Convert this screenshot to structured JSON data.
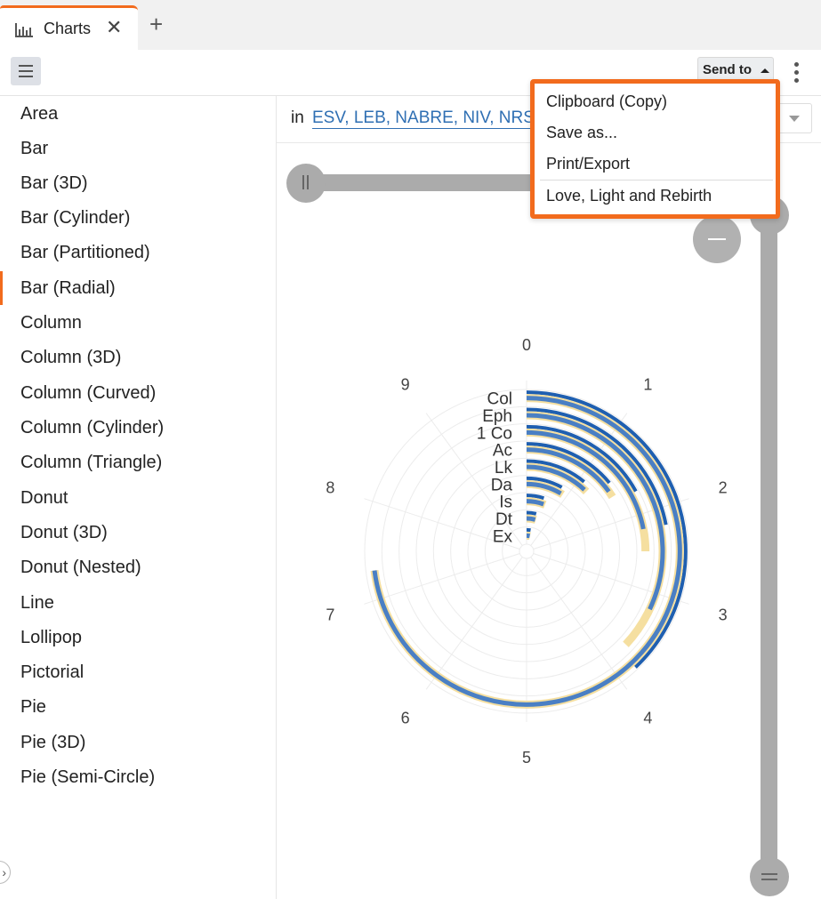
{
  "tab": {
    "title": "Charts",
    "icon": "bar-chart-icon"
  },
  "toolbar": {
    "send_to": "Send to"
  },
  "sidebar": {
    "items": [
      "Area",
      "Bar",
      "Bar (3D)",
      "Bar (Cylinder)",
      "Bar (Partitioned)",
      "Bar (Radial)",
      "Column",
      "Column (3D)",
      "Column (Curved)",
      "Column (Cylinder)",
      "Column (Triangle)",
      "Donut",
      "Donut (3D)",
      "Donut (Nested)",
      "Line",
      "Lollipop",
      "Pictorial",
      "Pie",
      "Pie (3D)",
      "Pie (Semi-Circle)"
    ],
    "selected": "Bar (Radial)"
  },
  "filter": {
    "in_label": "in",
    "versions": "ESV, LEB, NABRE, NIV, NRSV"
  },
  "dropdown": {
    "items": [
      "Clipboard (Copy)",
      "Save as...",
      "Print/Export",
      "Love, Light and Rebirth"
    ]
  },
  "colors": {
    "accent": "#f26b1d",
    "link": "#2f6fb3",
    "series_dark": "#1f5fb0",
    "series_mid": "#4a7fc4",
    "series_light": "#f5dfa0",
    "track": "#ababab"
  },
  "chart_data": {
    "type": "radial-bar",
    "angle_ticks": [
      "0",
      "1",
      "2",
      "3",
      "4",
      "5",
      "6",
      "7",
      "8",
      "9"
    ],
    "angle_range": [
      0,
      10
    ],
    "categories": [
      "Col",
      "Eph",
      "1 Co",
      "Ac",
      "Lk",
      "Da",
      "Is",
      "Dt",
      "Ex"
    ],
    "series": [
      {
        "color": "#1f5fb0",
        "values": [
          3.8,
          2.2,
          1.7,
          1.4,
          1.1,
          0.8,
          0.5,
          0.4,
          0.3
        ]
      },
      {
        "color": "#f5dfa0",
        "values": [
          7.3,
          3.7,
          2.5,
          1.6,
          1.25,
          0.9,
          0.6,
          0.45,
          0.35
        ]
      },
      {
        "color": "#4a7fc4",
        "values": [
          7.3,
          3.2,
          2.2,
          1.5,
          1.2,
          0.85,
          0.55,
          0.42,
          0.32
        ]
      }
    ]
  }
}
